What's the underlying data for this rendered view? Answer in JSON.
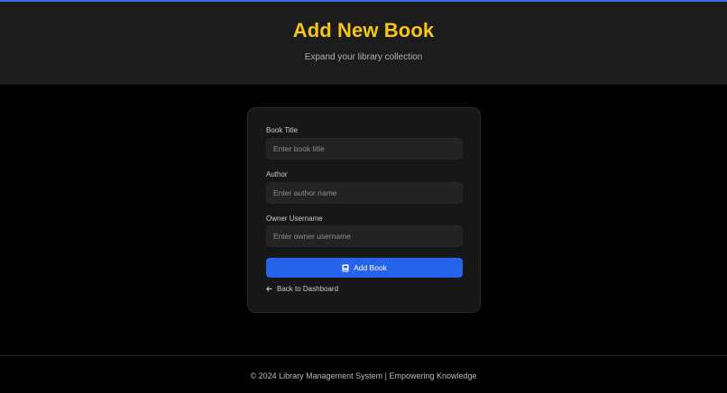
{
  "header": {
    "title": "Add New Book",
    "subtitle": "Expand your library collection"
  },
  "form": {
    "fields": [
      {
        "label": "Book Title",
        "placeholder": "Enter book title",
        "value": ""
      },
      {
        "label": "Author",
        "placeholder": "Enter author name",
        "value": ""
      },
      {
        "label": "Owner Username",
        "placeholder": "Enter owner username",
        "value": ""
      }
    ],
    "submit_label": "Add Book",
    "back_label": "Back to Dashboard"
  },
  "footer": {
    "text": "© 2024 Library Management System | Empowering Knowledge"
  },
  "colors": {
    "accent": "#2563eb",
    "title": "#f5c518",
    "background": "#000000",
    "card": "#171717"
  },
  "icons": {
    "submit": "book-icon",
    "back": "arrow-left-icon"
  }
}
